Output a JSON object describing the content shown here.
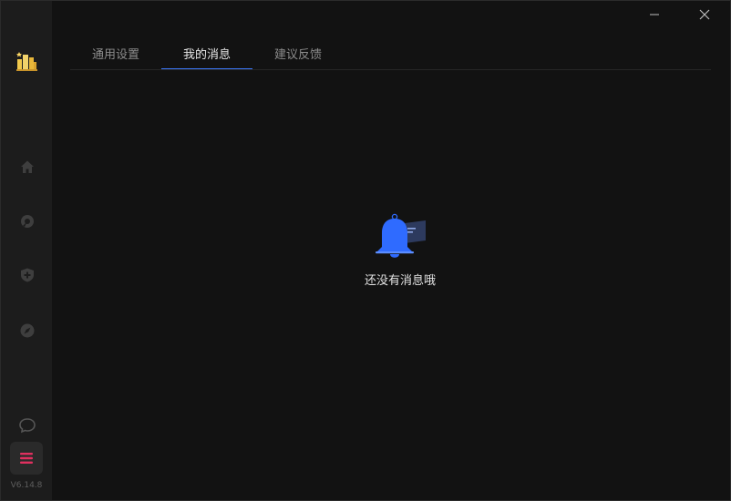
{
  "tabs": [
    {
      "label": "通用设置"
    },
    {
      "label": "我的消息"
    },
    {
      "label": "建议反馈"
    }
  ],
  "empty_state": {
    "message": "还没有消息哦"
  },
  "sidebar": {
    "logo_icon": "city-logo-icon",
    "items": [
      {
        "icon": "home-icon"
      },
      {
        "icon": "speed-icon"
      },
      {
        "icon": "shield-plus-icon"
      },
      {
        "icon": "compass-icon"
      }
    ],
    "feedback_icon": "chat-bubble-icon",
    "menu_icon": "hamburger-menu-icon",
    "version": "V6.14.8"
  },
  "window_controls": {
    "minimize": "minimize-icon",
    "close": "close-icon"
  },
  "colors": {
    "accent": "#3d7bff",
    "background": "#121212",
    "sidebar": "#1c1c1c",
    "menu": "#e0305f"
  }
}
